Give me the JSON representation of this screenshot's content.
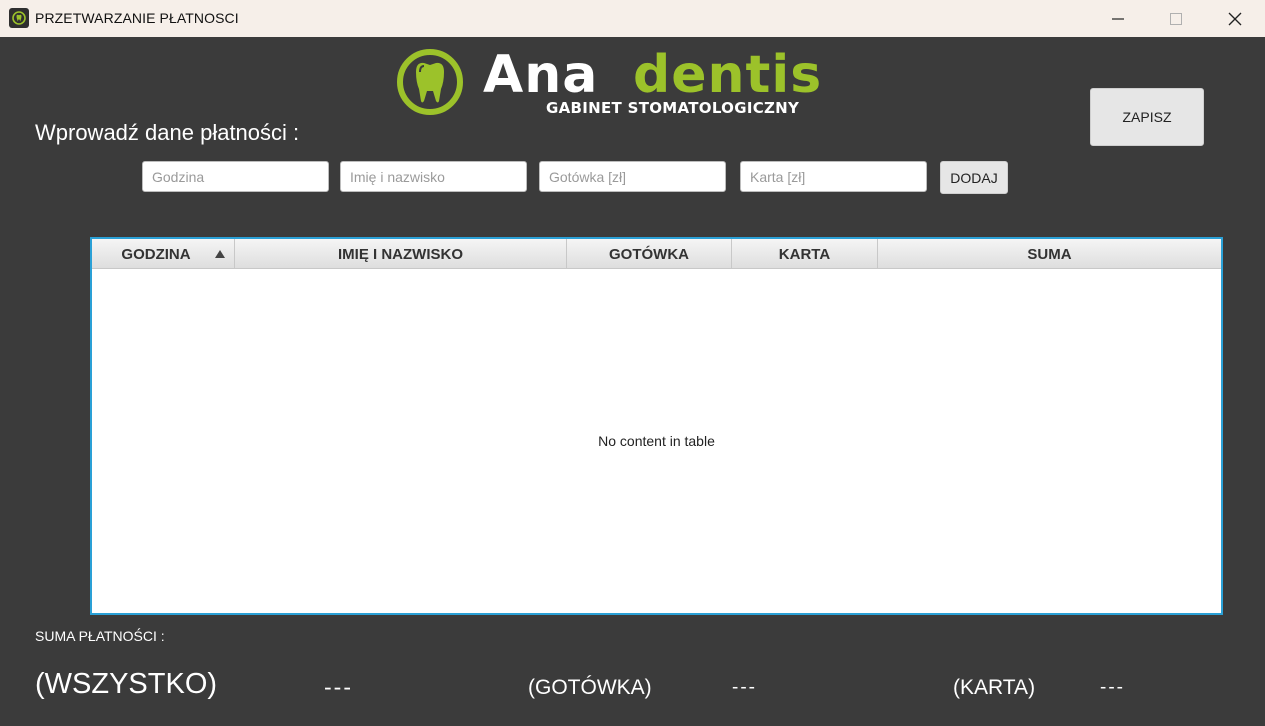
{
  "window": {
    "title": "PRZETWARZANIE PŁATNOSCI",
    "icon": "tooth-app-icon",
    "controls": [
      "minimize-icon",
      "maximize-icon",
      "close-icon"
    ]
  },
  "logo": {
    "word_part1": "Ana",
    "word_part2": "dentis",
    "subtitle": "GABINET STOMATOLOGICZNY",
    "icon": "tooth-ring-icon",
    "colors": {
      "accent": "#9cc22a",
      "text": "#ffffff"
    }
  },
  "form": {
    "label": "Wprowadź dane płatności :",
    "fields": {
      "godzina_placeholder": "Godzina",
      "imie_placeholder": "Imię i nazwisko",
      "gotowka_placeholder": "Gotówka [zł]",
      "karta_placeholder": "Karta [zł]"
    },
    "add_button": "DODAJ"
  },
  "save_button": "ZAPISZ",
  "table": {
    "columns": [
      "GODZINA",
      "IMIĘ I NAZWISKO",
      "GOTÓWKA",
      "KARTA",
      "SUMA"
    ],
    "sorted_column": "GODZINA",
    "sort_direction": "ascending",
    "rows": [],
    "empty_message": "No content in table",
    "focus_color": "#2aa0d6"
  },
  "summary": {
    "label": "SUMA PŁATNOŚCI :",
    "all_label": "(WSZYSTKO)",
    "all_value": "---",
    "cash_label": "(GOTÓWKA)",
    "cash_value": "---",
    "card_label": "(KARTA)",
    "card_value": "---"
  },
  "colors": {
    "background": "#3b3b3b",
    "titlebar": "#f6efe9"
  }
}
